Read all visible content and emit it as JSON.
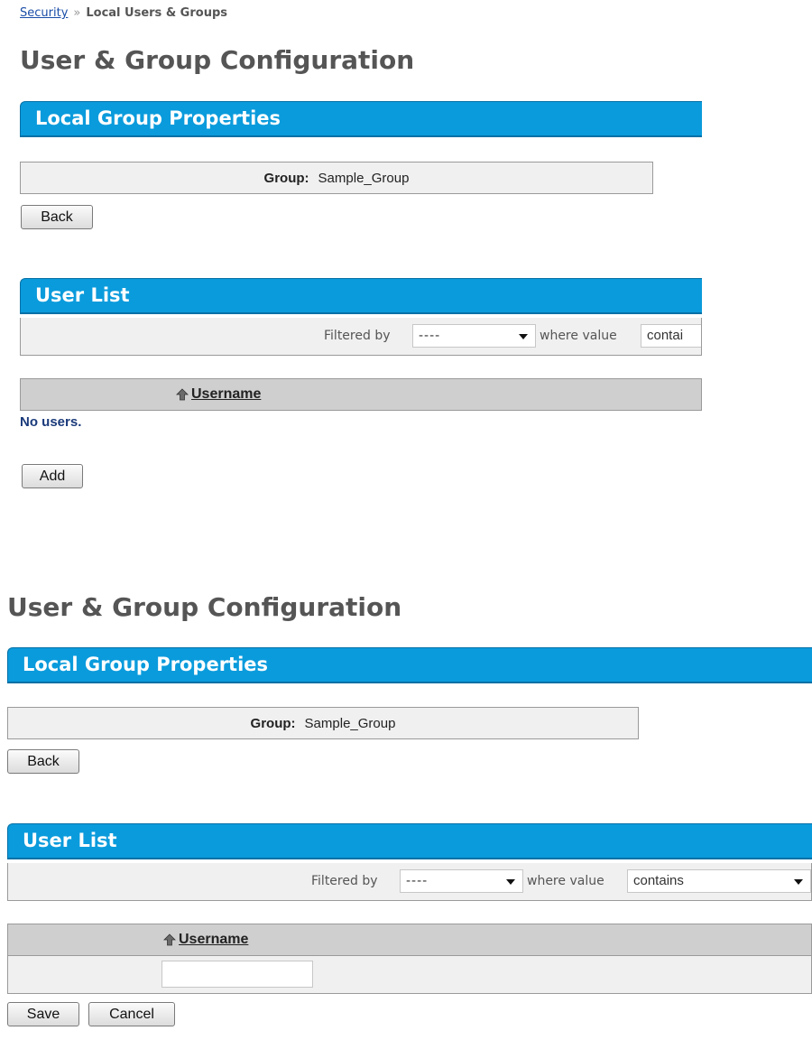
{
  "breadcrumb": {
    "link": "Security",
    "separator": "»",
    "current": "Local Users & Groups"
  },
  "colors": {
    "header_blue": "#0a9bdc",
    "row_grey": "#f0f0f0",
    "table_head": "#cfcfcf",
    "link_blue": "#1a4ea8"
  },
  "panels": [
    {
      "page_title": "User & Group Configuration",
      "group_section_title": "Local Group Properties",
      "group_label": "Group:",
      "group_value": "Sample_Group",
      "back_label": "Back",
      "user_list_title": "User List",
      "filter": {
        "label": "Filtered by",
        "field_value": "----",
        "where_label": "where value",
        "operator_value": "contai"
      },
      "column_header": "Username",
      "empty_text": "No users.",
      "add_label": "Add"
    },
    {
      "page_title": "User & Group Configuration",
      "group_section_title": "Local Group Properties",
      "group_label": "Group:",
      "group_value": "Sample_Group",
      "back_label": "Back",
      "user_list_title": "User List",
      "filter": {
        "label": "Filtered by",
        "field_value": "----",
        "where_label": "where value",
        "operator_value": "contains"
      },
      "column_header": "Username",
      "username_input_value": "",
      "save_label": "Save",
      "cancel_label": "Cancel"
    }
  ]
}
